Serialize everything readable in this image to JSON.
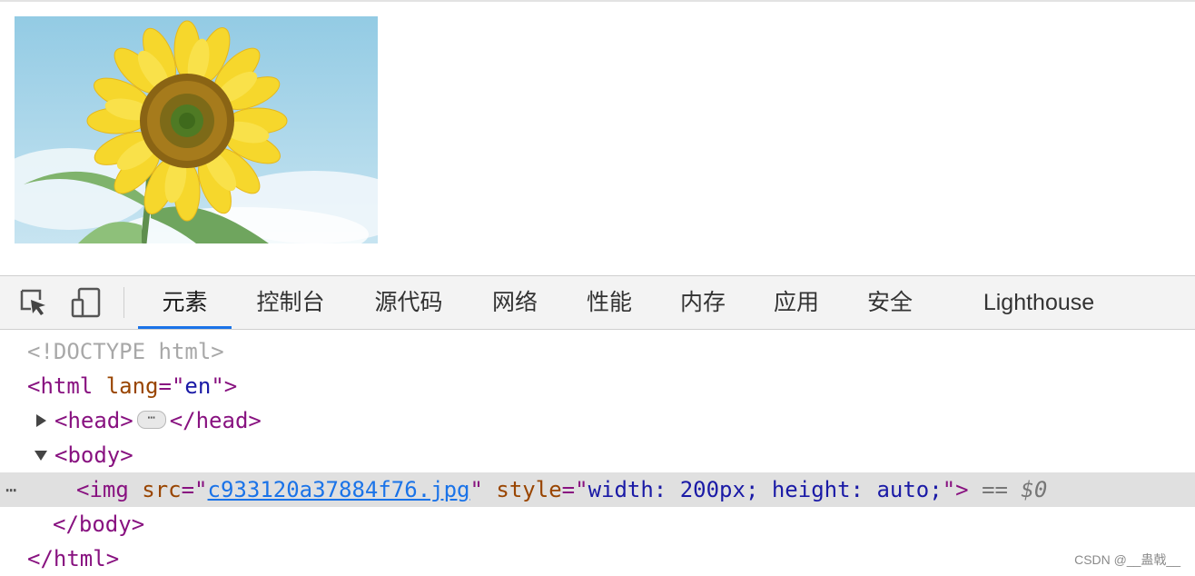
{
  "preview": {
    "image_subject": "sunflower",
    "colors": {
      "sky": "#9fd0e6",
      "petal": "#f5d22a",
      "center": "#7a5a12",
      "leaf": "#6fae6f"
    }
  },
  "toolbar": {
    "icons": {
      "inspect": "inspect-element-icon",
      "device": "device-toolbar-icon"
    },
    "tabs": [
      {
        "label": "元素",
        "active": true
      },
      {
        "label": "控制台"
      },
      {
        "label": "源代码"
      },
      {
        "label": "网络"
      },
      {
        "label": "性能"
      },
      {
        "label": "内存"
      },
      {
        "label": "应用"
      },
      {
        "label": "安全"
      },
      {
        "label": "Lighthouse"
      }
    ],
    "accent": "#1a73e8"
  },
  "dom": {
    "doctype": "<!DOCTYPE html>",
    "html_open": {
      "open": "<html",
      "attr": "lang",
      "eq": "=\"",
      "val": "en",
      "close": "\">"
    },
    "head": {
      "open": "<head>",
      "close": "</head>",
      "badge": "⋯"
    },
    "body_open": "<body>",
    "img": {
      "open": "<img",
      "src_attr": "src",
      "src_val": "c933120a37884f76.jpg",
      "style_attr": "style",
      "style_val": "width: 200px; height: auto;",
      "close": "\">",
      "eq_ref": "==",
      "ref": "$0",
      "row_dots": "⋯"
    },
    "body_close": "</body>",
    "html_close": "</html>"
  },
  "watermark": "CSDN @__蛊戟__"
}
